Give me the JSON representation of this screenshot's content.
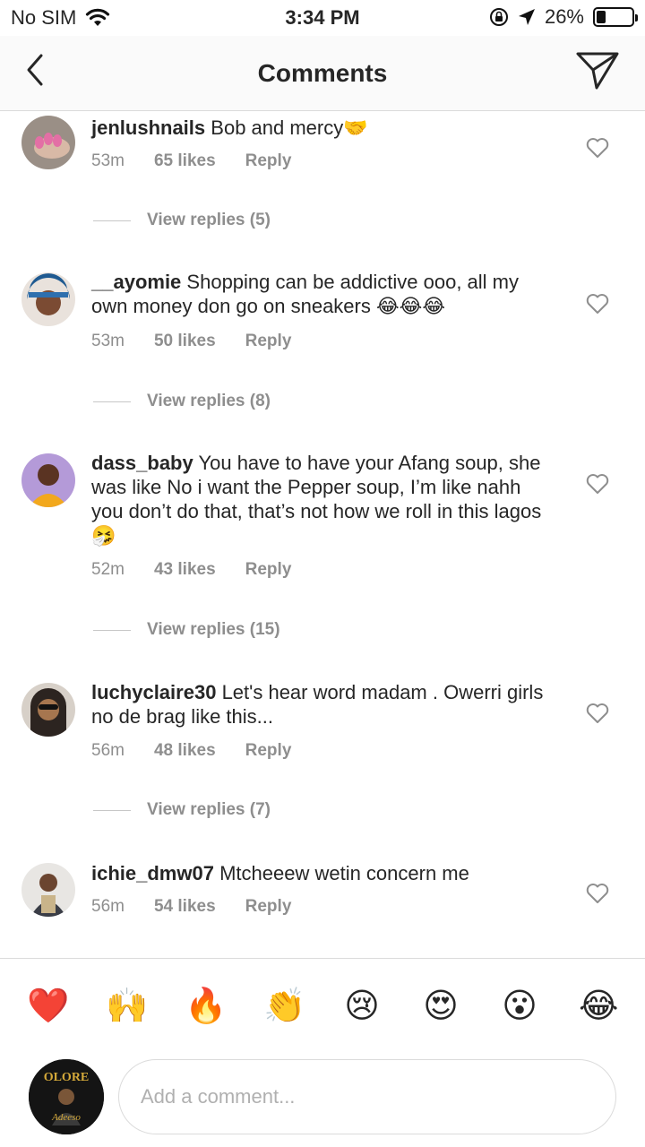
{
  "status": {
    "carrier": "No SIM",
    "time": "3:34 PM",
    "battery": "26%",
    "battery_level": 0.26
  },
  "nav": {
    "title": "Comments"
  },
  "comments": [
    {
      "username": "jenlushnails",
      "text": "Bob and mercy🤝",
      "time": "53m",
      "likes": "65 likes",
      "reply": "Reply",
      "view_replies": "View replies (5)"
    },
    {
      "username": "__ayomie",
      "text": "Shopping can be addictive ooo, all my own money don go on sneakers 😂😂😂",
      "time": "53m",
      "likes": "50 likes",
      "reply": "Reply",
      "view_replies": "View replies (8)"
    },
    {
      "username": "dass_baby",
      "text": "You have to have your Afang soup, she was like No i want the Pepper soup, I’m like nahh you don’t do that, that’s not how we roll in this lagos🤧",
      "time": "52m",
      "likes": "43 likes",
      "reply": "Reply",
      "view_replies": "View replies (15)"
    },
    {
      "username": "luchyclaire30",
      "text": "Let's hear word madam . Owerri girls no de brag like this...",
      "time": "56m",
      "likes": "48 likes",
      "reply": "Reply",
      "view_replies": "View replies (7)"
    },
    {
      "username": "ichie_dmw07",
      "text": "Mtcheeew wetin concern me",
      "time": "56m",
      "likes": "54 likes",
      "reply": "Reply"
    }
  ],
  "emoji_bar": [
    "❤️",
    "🙌",
    "🔥",
    "👏",
    "😢",
    "😍",
    "😮",
    "😂"
  ],
  "input": {
    "placeholder": "Add a comment..."
  },
  "my_avatar": {
    "logo_text": "OLORE",
    "logo_sub": "Adeeso"
  }
}
